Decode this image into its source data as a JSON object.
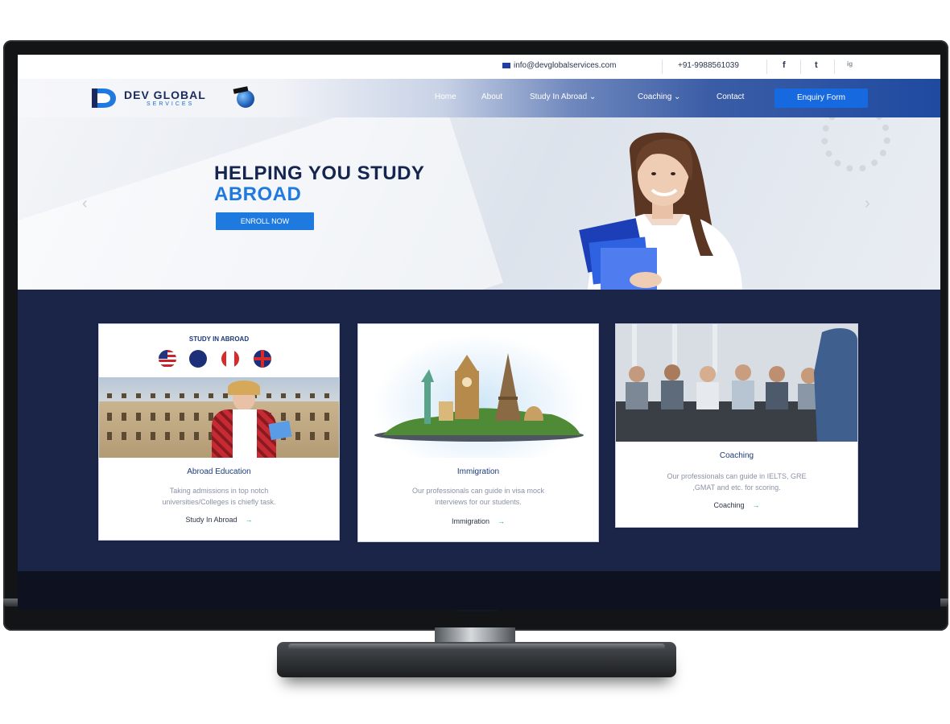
{
  "topbar": {
    "email": "info@devglobalservices.com",
    "phone": "+91-9988561039",
    "social": [
      "f",
      "t",
      "ig"
    ]
  },
  "nav": {
    "logo_title": "DEV GLOBAL",
    "logo_sub": "SERVICES",
    "items": [
      {
        "label": "Home"
      },
      {
        "label": "About"
      },
      {
        "label": "Study In Abroad ⌄"
      },
      {
        "label": "Coaching ⌄"
      },
      {
        "label": "Contact"
      }
    ],
    "cta": "Enquiry Form"
  },
  "hero": {
    "headline_1": "HELPING YOU STUDY",
    "headline_2": "ABROAD",
    "button": "ENROLL NOW",
    "prev_arrow": "‹",
    "next_arrow": "›"
  },
  "cards": [
    {
      "image_caption": "STUDY IN ABROAD",
      "title": "Abroad Education",
      "desc_1": "Taking admissions in top notch",
      "desc_2": "universities/Colleges is chiefly task.",
      "link": "Study In Abroad",
      "arrow": "→"
    },
    {
      "title": "Immigration",
      "desc_1": "Our professionals can guide in visa mock",
      "desc_2": "interviews for our students.",
      "link": "Immigration",
      "arrow": "→"
    },
    {
      "title": "Coaching",
      "desc_1": "Our professionals can guide in IELTS, GRE",
      "desc_2": ",GMAT and etc. for scoring.",
      "link": "Coaching",
      "arrow": "→"
    }
  ],
  "colors": {
    "brand_blue": "#1f7ae0",
    "navy": "#14254f",
    "services_bg": "#1a2548"
  }
}
